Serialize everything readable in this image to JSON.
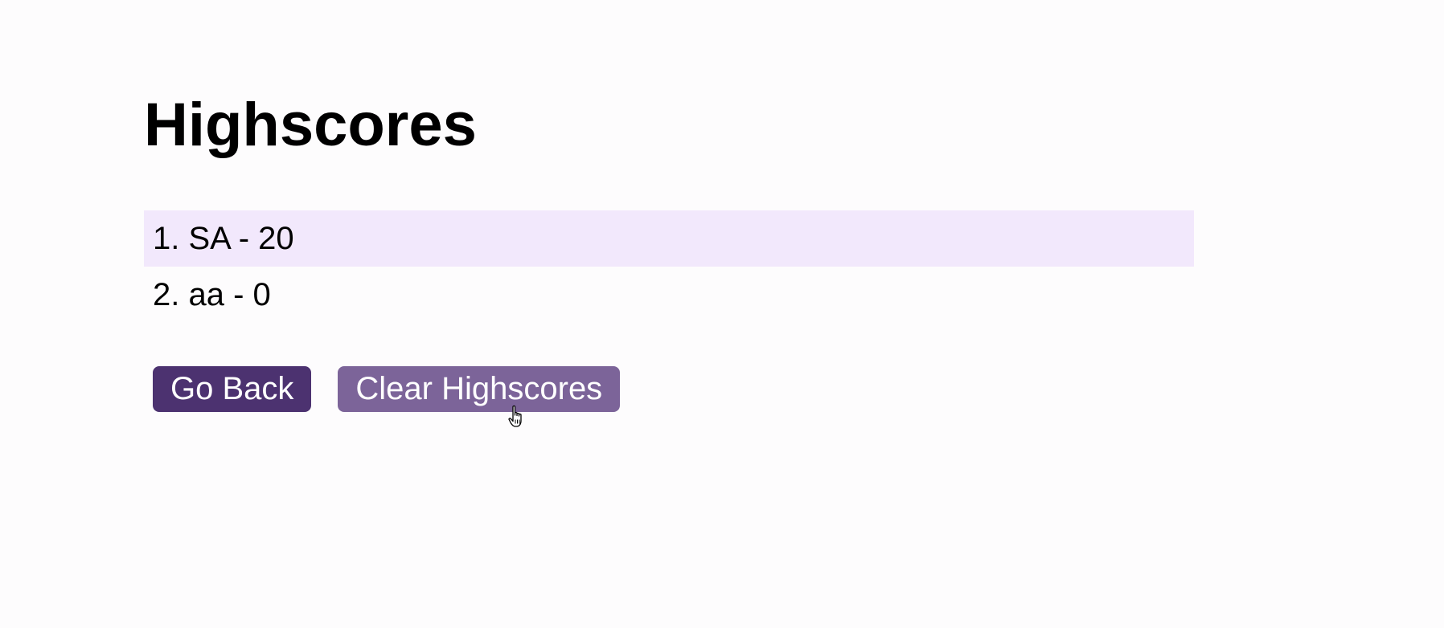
{
  "page": {
    "title": "Highscores"
  },
  "scores": [
    {
      "text": "1. SA - 20"
    },
    {
      "text": "2. aa - 0"
    }
  ],
  "actions": {
    "go_back_label": "Go Back",
    "clear_label": "Clear Highscores"
  },
  "colors": {
    "highlight_row": "#f2e8fc",
    "go_back_button": "#4c3270",
    "clear_button": "#7c6499",
    "button_text": "#ffffff"
  },
  "cursor": {
    "icon": "hand-pointer-icon"
  }
}
